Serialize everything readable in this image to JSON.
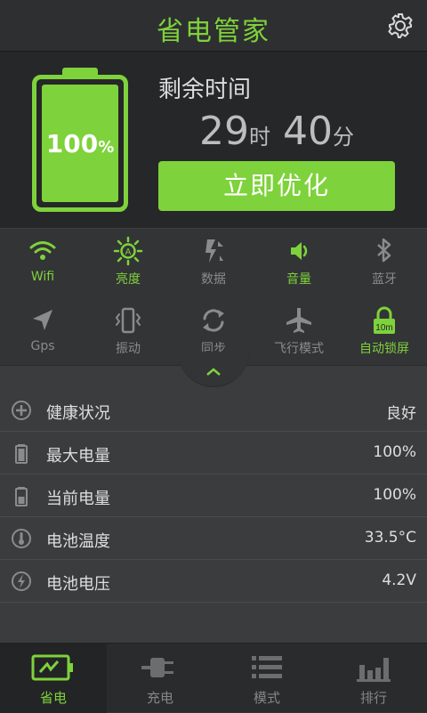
{
  "header": {
    "title": "省电管家",
    "settings_icon": "gear-icon"
  },
  "battery": {
    "percent_number": "100",
    "percent_sign": "%",
    "level": 1.0,
    "remaining_label": "剩余时间",
    "hours": "29",
    "hours_unit": "时",
    "minutes": "40",
    "minutes_unit": "分",
    "optimize_label": "立即优化"
  },
  "toggles": [
    {
      "label": "Wifi",
      "icon": "wifi-icon",
      "on": true
    },
    {
      "label": "亮度",
      "icon": "brightness-icon",
      "on": true
    },
    {
      "label": "数据",
      "icon": "data-icon",
      "on": false
    },
    {
      "label": "音量",
      "icon": "volume-icon",
      "on": true
    },
    {
      "label": "蓝牙",
      "icon": "bluetooth-icon",
      "on": false
    },
    {
      "label": "Gps",
      "icon": "gps-icon",
      "on": false
    },
    {
      "label": "振动",
      "icon": "vibrate-icon",
      "on": false
    },
    {
      "label": "同步",
      "icon": "sync-icon",
      "on": false
    },
    {
      "label": "飞行模式",
      "icon": "airplane-icon",
      "on": false
    },
    {
      "label": "自动锁屏",
      "icon": "lock-icon",
      "on": true,
      "badge": "10m"
    }
  ],
  "info": [
    {
      "name": "健康状况",
      "value": "良好",
      "icon": "health-icon"
    },
    {
      "name": "最大电量",
      "value": "100%",
      "icon": "battery-full-icon"
    },
    {
      "name": "当前电量",
      "value": "100%",
      "icon": "battery-current-icon"
    },
    {
      "name": "电池温度",
      "value": "33.5°C",
      "icon": "thermometer-icon"
    },
    {
      "name": "电池电压",
      "value": "4.2V",
      "icon": "voltage-icon"
    }
  ],
  "nav": [
    {
      "label": "省电",
      "icon": "battery-save-icon",
      "active": true
    },
    {
      "label": "充电",
      "icon": "plug-icon",
      "active": false
    },
    {
      "label": "模式",
      "icon": "list-icon",
      "active": false
    },
    {
      "label": "排行",
      "icon": "ranking-icon",
      "active": false
    }
  ],
  "colors": {
    "accent": "#7ed23b",
    "inactive": "#8a8b8d",
    "background": "#333436"
  }
}
